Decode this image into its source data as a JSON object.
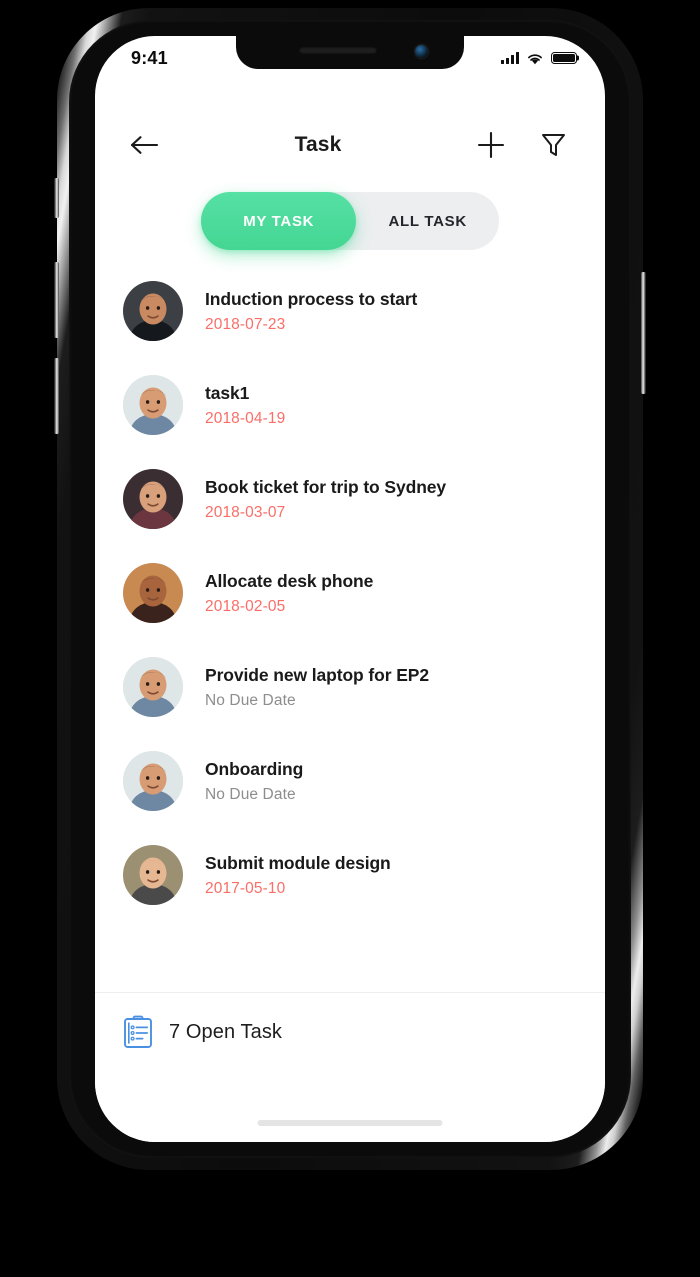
{
  "device": {
    "frame_name": "smartphone-mockup",
    "accent_green": "#44d693",
    "date_red": "#fa6e68",
    "muted_gray": "#8d8d8d",
    "icon_blue": "#4a90e2"
  },
  "status_bar": {
    "time": "9:41",
    "signal_icon": "cellular-signal-icon",
    "wifi_icon": "wifi-icon",
    "battery_icon": "battery-full-icon"
  },
  "header": {
    "back_icon": "arrow-left-icon",
    "title": "Task",
    "add_icon": "plus-icon",
    "filter_icon": "filter-funnel-icon"
  },
  "tabs": {
    "items": [
      {
        "label": "MY TASK",
        "active": true
      },
      {
        "label": "ALL TASK",
        "active": false
      }
    ]
  },
  "tasks": [
    {
      "title": "Induction process to start",
      "date": "2018-07-23",
      "has_due_date": true,
      "avatar": "avatar-man-dark-shirt"
    },
    {
      "title": "task1",
      "date": "2018-04-19",
      "has_due_date": true,
      "avatar": "avatar-man-beard-denim"
    },
    {
      "title": "Book ticket for trip to Sydney",
      "date": "2018-03-07",
      "has_due_date": true,
      "avatar": "avatar-woman-glasses"
    },
    {
      "title": "Allocate desk phone",
      "date": "2018-02-05",
      "has_due_date": true,
      "avatar": "avatar-man-moustache"
    },
    {
      "title": "Provide new laptop for EP2",
      "date": "No Due Date",
      "has_due_date": false,
      "avatar": "avatar-man-beard-denim"
    },
    {
      "title": "Onboarding",
      "date": "No Due Date",
      "has_due_date": false,
      "avatar": "avatar-man-beard-denim"
    },
    {
      "title": "Submit module design",
      "date": "2017-05-10",
      "has_due_date": true,
      "avatar": "avatar-woman-blonde"
    }
  ],
  "footer": {
    "icon": "clipboard-checklist-icon",
    "summary": "7 Open Task"
  }
}
